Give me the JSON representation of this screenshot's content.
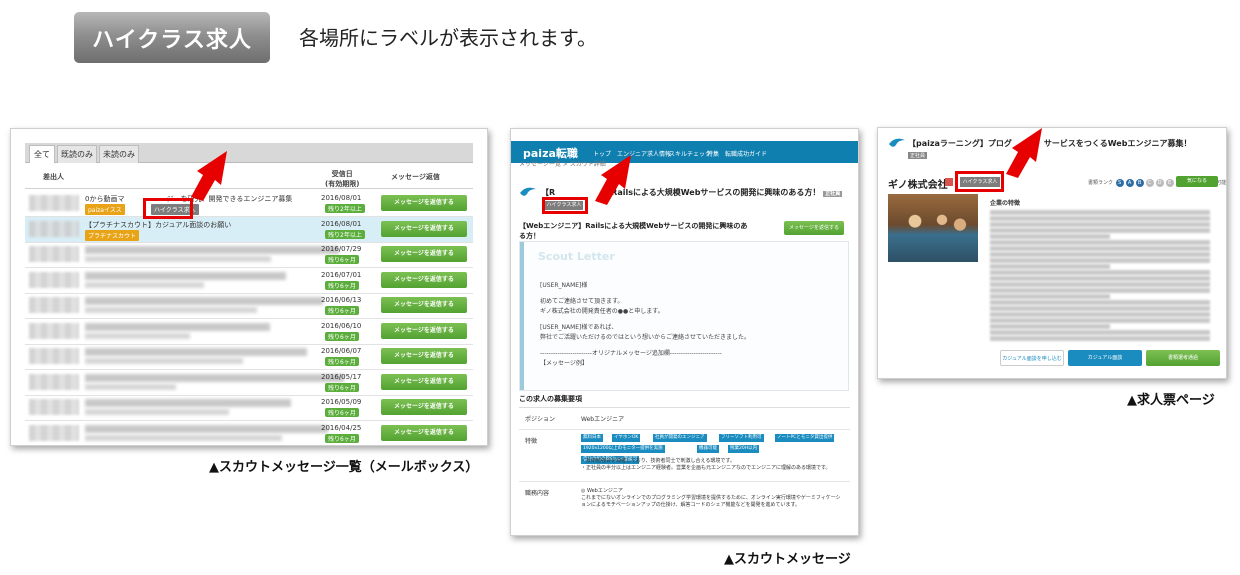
{
  "heading": {
    "badge": "ハイクラス求人",
    "description": "各場所にラベルが表示されます。"
  },
  "captions": {
    "mailbox": "▲スカウトメッセージ一覧（メールボックス）",
    "message": "▲スカウトメッセージ",
    "jobpage": "▲求人票ページ"
  },
  "mailbox": {
    "tabs": [
      "全て",
      "既読のみ",
      "未読のみ"
    ],
    "columns": {
      "sender": "差出人",
      "date": "受信日\n(有効期限)",
      "reply": "メッセージ返信"
    },
    "rows": [
      {
        "date": "2016/08/01",
        "left": "残り2年以上",
        "button": "メッセージを返信する"
      },
      {
        "date": "2016/08/01",
        "left": "残り2年以上",
        "button": "メッセージを返信する"
      },
      {
        "date": "2016/07/29",
        "left": "残り6ヶ月",
        "button": "メッセージを返信する"
      },
      {
        "date": "2016/07/01",
        "left": "残り6ヶ月",
        "button": "メッセージを返信する"
      },
      {
        "date": "2016/06/13",
        "left": "残り6ヶ月",
        "button": "メッセージを返信する"
      },
      {
        "date": "2016/06/10",
        "left": "残り6ヶ月",
        "button": "メッセージを返信する"
      },
      {
        "date": "2016/06/07",
        "left": "残り6ヶ月",
        "button": "メッセージを返信する"
      },
      {
        "date": "2016/05/17",
        "left": "残り6ヶ月",
        "button": "メッセージを返信する"
      },
      {
        "date": "2016/05/09",
        "button": "メッセージを返信する",
        "left": "残り6ヶ月"
      },
      {
        "date": "2016/04/25",
        "left": "残り6ヶ月",
        "button": "メッセージを返信する"
      }
    ],
    "row1_text": "0から動画マ　　　　　　ジーを研究、開発できるエンジニア募集",
    "row1_label": "ハイクラス求人",
    "row1_tag": "paizaイスス",
    "row2_text": "【プラチナスカウト】カジュアル面談のお願い",
    "row2_tag": "プラチナスカウト"
  },
  "message": {
    "logo": "paiza転職",
    "menu": [
      "トップ",
      "エンジニア求人情報",
      "スキルチェック",
      "特集",
      "転職成功ガイド"
    ],
    "breadcrumb": "メッセージ一覧 > スカウト詳細",
    "title": "【R　　　　　　　Railsによる大規模Webサービスの開発に興味のある方！",
    "title_tag": "正社員",
    "label": "ハイクラス求人",
    "subject": "【Webエンジニア】Railsによる大規模Webサービスの開発に興味のある方！",
    "reply_button": "メッセージを返信する",
    "letter": {
      "brand": "Scout Letter",
      "lines": [
        "[USER_NAME]様",
        "初めてご連絡させて頂きます。",
        "ギノ株式会社の開発責任者の●●と申します。",
        "[USER_NAME]様であれば、",
        "弊社でご活躍いただけるのではという想いからご連絡させていただきました。",
        "------------------------オリジナルメッセージ追加欄------------------------",
        "【メッセージ例】"
      ]
    },
    "section_title": "この求人の募集要項",
    "table": [
      {
        "label": "ポジション",
        "value": "Webエンジニア"
      },
      {
        "label": "特徴",
        "value": "・技術勉強会を開催しており、技術者同士で刺激し合える環境です。\n・正社員の半分以上はエンジニア経験者。営業を企画も元エンジニアなのでエンジニアに理解のある環境です。"
      },
      {
        "label": "職務内容",
        "value": "◎ Webエンジニア\nこれまでにないオンラインでのプログラミング学習環境を提供するために、オンライン実行環境やゲーミフィケーションによるモチベーションアップの仕掛け、解答コードのシェア機能などを開発を進めています。"
      }
    ],
    "tags": [
      "無料日本",
      "イヤホンOK",
      "社員が開発のエンジニア",
      "フリーソフト利用可",
      "ノートPCとモニタ貸出提供",
      "1920x1200以上のモニター提供を実施",
      "機器可能",
      "残業20H以内",
      "自分の机の目Skype面談可"
    ]
  },
  "jobpage": {
    "title": "【paizaラーニング】プログ　　　　サービスをつくるWebエンジニア募集！",
    "employment": "正社員",
    "company": "ギノ株式会社",
    "label": "ハイクラス求人",
    "rank_text": "書類ランク",
    "rank_letters": [
      "S",
      "A",
      "B",
      "C",
      "D",
      "E"
    ],
    "rank_note": "ランク指定で応募可能",
    "main_button": "気になる",
    "intro_heading": "企業の特徴",
    "buttons": [
      "カジュアル面談を申し込む",
      "カジュアル面談",
      "書類選考通過"
    ]
  },
  "colors": {
    "green": "#5aa83a",
    "red": "#e60000",
    "navy": "#0f7fb0",
    "label_gray": "#7d7d7d"
  }
}
